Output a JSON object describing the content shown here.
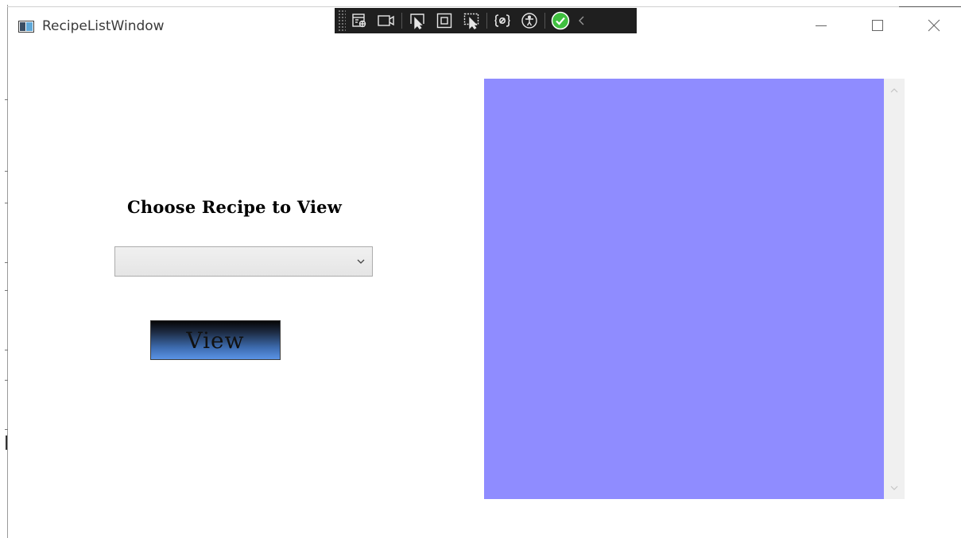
{
  "window": {
    "title": "RecipeListWindow"
  },
  "debug_toolbar": {
    "items": [
      {
        "name": "go-to-live-visual-tree-icon"
      },
      {
        "name": "show-in-app-toolbar-icon"
      },
      {
        "name": "select-element-icon"
      },
      {
        "name": "display-layout-adorners-icon"
      },
      {
        "name": "track-focused-element-icon"
      },
      {
        "name": "hot-reload-icon"
      },
      {
        "name": "accessibility-icon"
      },
      {
        "name": "binding-status-ok-icon"
      },
      {
        "name": "collapse-toolbar-icon"
      }
    ]
  },
  "main": {
    "heading": "Choose Recipe to View",
    "combo": {
      "selected_value": ""
    },
    "view_button_label": "View"
  },
  "recipe_list": {
    "items": []
  },
  "colors": {
    "list_background": "#8f8cff",
    "button_gradient_top": "#050505",
    "button_gradient_bottom": "#5a93e6",
    "toolbar_background": "#1f1f1f",
    "status_ok": "#3fbf3f"
  }
}
